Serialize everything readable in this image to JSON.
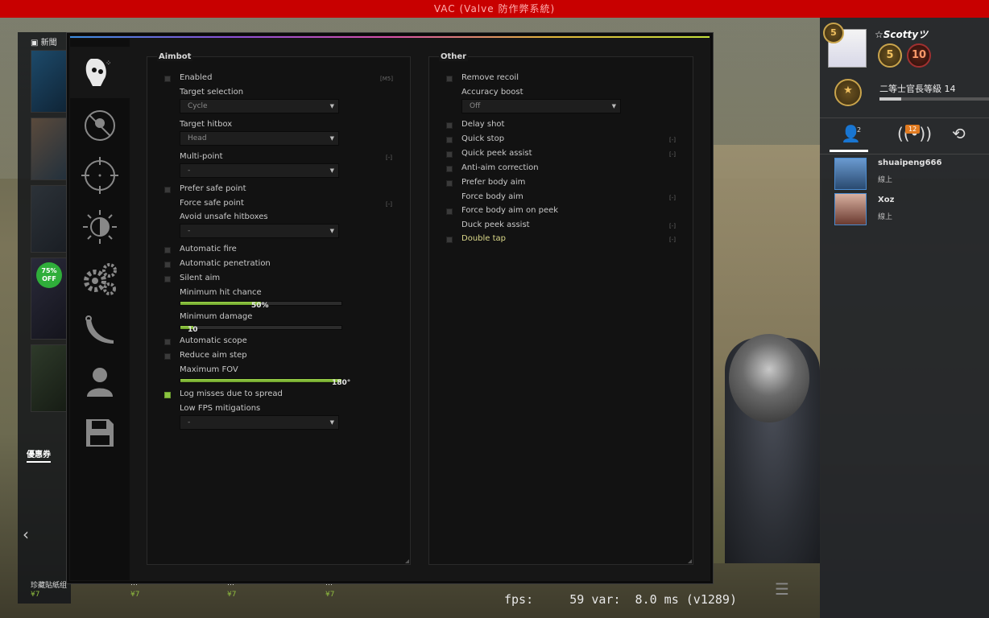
{
  "topbar": {
    "title": "VAC (Valve 防作弊系統)"
  },
  "news": {
    "title": "新聞",
    "promo_badge": "75%",
    "promo_badge_sub": "OFF",
    "coupon_label": "優惠券"
  },
  "store": {
    "items": [
      {
        "name": "珍藏貼紙组",
        "price": "¥7"
      },
      {
        "name": "…",
        "price": "¥7"
      },
      {
        "name": "…",
        "price": "¥7"
      },
      {
        "name": "…",
        "price": "¥7"
      }
    ]
  },
  "social": {
    "username": "☆Scottyツ",
    "level_coin": "5",
    "medals": [
      "5",
      "10"
    ],
    "rank_text": "二等士官長等級",
    "rank_level": "14",
    "rank_progress": 0.2,
    "friends_count": "2",
    "notif_count": "12",
    "friends": [
      {
        "name": "shuaipeng666",
        "status": "線上"
      },
      {
        "name": "Xoz",
        "status": "線上"
      }
    ]
  },
  "overlay": {
    "fps_text": "fps:     59 var:  8.0 ms (v1289)"
  },
  "nav_icons": [
    "skull-icon",
    "no-crosshair-icon",
    "crosshair-icon",
    "brightness-icon",
    "gears-icon",
    "knife-icon",
    "user-icon",
    "save-icon"
  ],
  "aimbot": {
    "title": "Aimbot",
    "enabled_label": "Enabled",
    "enabled_key": "[M5]",
    "target_selection_label": "Target selection",
    "target_selection_value": "Cycle",
    "target_hitbox_label": "Target hitbox",
    "target_hitbox_value": "Head",
    "multipoint_label": "Multi-point",
    "multipoint_key": "[-]",
    "multipoint_value": "-",
    "prefer_safe_label": "Prefer safe point",
    "force_safe_label": "Force safe point",
    "force_safe_key": "[-]",
    "avoid_unsafe_label": "Avoid unsafe hitboxes",
    "avoid_unsafe_value": "-",
    "auto_fire_label": "Automatic fire",
    "auto_pen_label": "Automatic penetration",
    "silent_label": "Silent aim",
    "min_hit_label": "Minimum hit chance",
    "min_hit_value": "50%",
    "min_hit_fraction": 0.5,
    "min_dmg_label": "Minimum damage",
    "min_dmg_value": "10",
    "min_dmg_fraction": 0.08,
    "auto_scope_label": "Automatic scope",
    "reduce_step_label": "Reduce aim step",
    "max_fov_label": "Maximum FOV",
    "max_fov_value": "180°",
    "max_fov_fraction": 1.0,
    "log_misses_label": "Log misses due to spread",
    "low_fps_label": "Low FPS mitigations",
    "low_fps_value": "-"
  },
  "other": {
    "title": "Other",
    "remove_recoil_label": "Remove recoil",
    "accuracy_boost_label": "Accuracy boost",
    "accuracy_boost_value": "Off",
    "delay_shot_label": "Delay shot",
    "quick_stop_label": "Quick stop",
    "quick_stop_key": "[-]",
    "quick_peek_label": "Quick peek assist",
    "quick_peek_key": "[-]",
    "anti_aim_corr_label": "Anti-aim correction",
    "prefer_body_label": "Prefer body aim",
    "force_body_label": "Force body aim",
    "force_body_key": "[-]",
    "force_body_peek_label": "Force body aim on peek",
    "duck_peek_label": "Duck peek assist",
    "duck_peek_key": "[-]",
    "double_tap_label": "Double tap",
    "double_tap_key": "[-]"
  }
}
